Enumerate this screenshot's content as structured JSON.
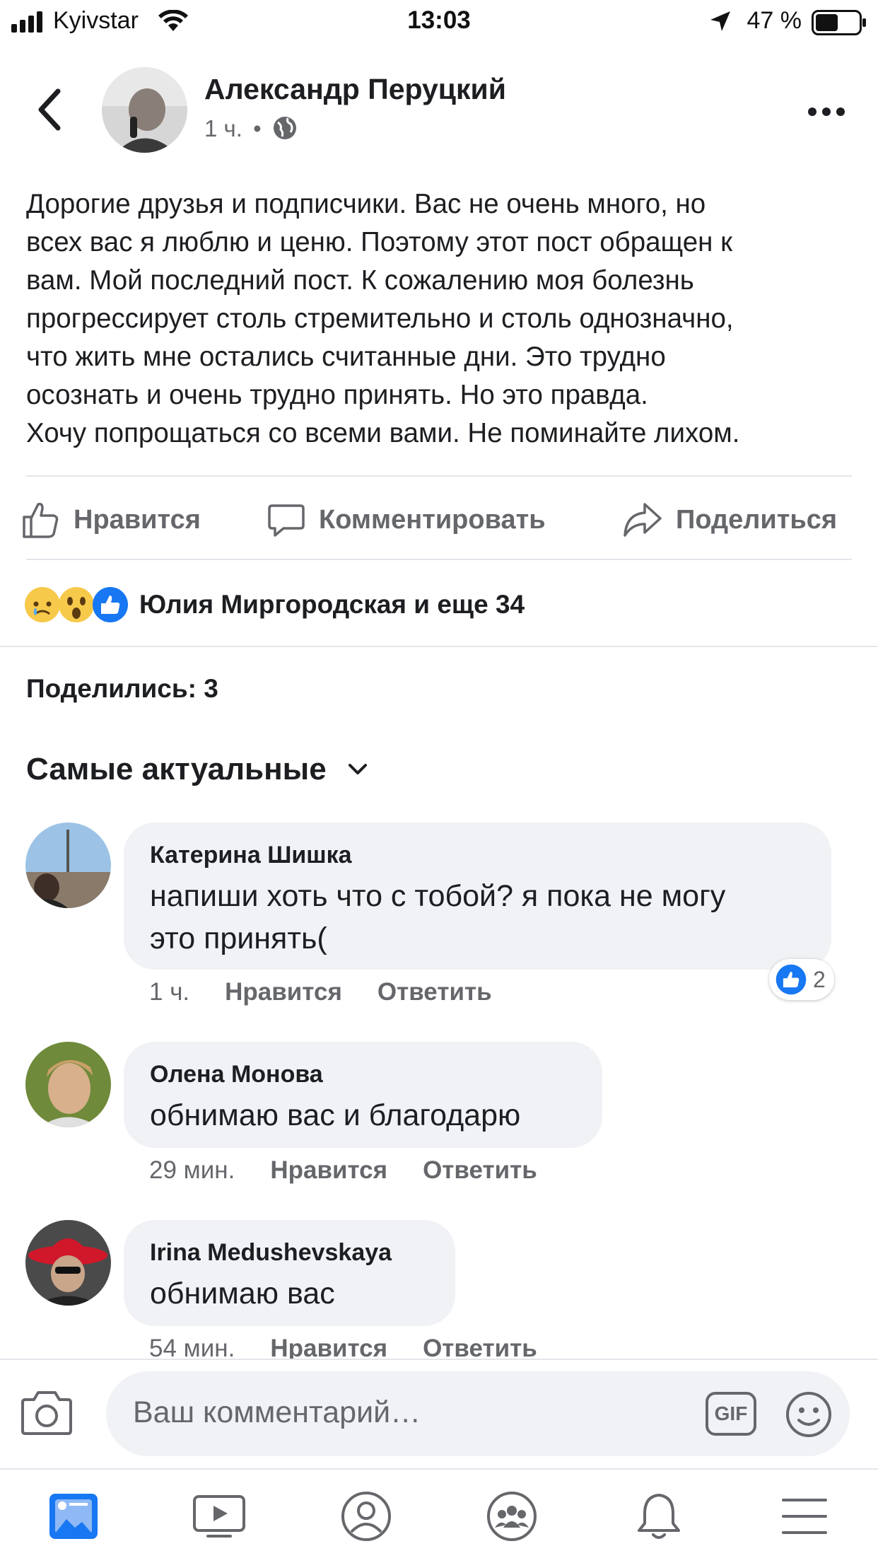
{
  "status_bar": {
    "carrier": "Kyivstar",
    "time": "13:03",
    "battery": "47 %"
  },
  "post": {
    "author": "Александр Перуцкий",
    "time": "1 ч.",
    "separator": "•",
    "text": "Дорогие друзья и подписчики. Вас не очень много, но\nвсех вас я люблю и ценю. Поэтому этот пост обращен к\nвам. Мой последний пост.  К сожалению моя болезнь\nпрогрессирует столь стремительно и столь однозначно,\nчто жить мне остались считанные дни. Это трудно\nосознать и очень трудно принять. Но это правда.\nХочу попрощаться со всеми вами. Не поминайте лихом."
  },
  "actions": {
    "like": "Нравится",
    "comment": "Комментировать",
    "share": "Поделиться"
  },
  "reactions": {
    "summary": "Юлия Миргородская и еще 34",
    "types": [
      "sad",
      "wow",
      "like"
    ]
  },
  "shares_text": "Поделились: 3",
  "sort_label": "Самые актуальные",
  "comments": [
    {
      "name": "Катерина Шишка",
      "text_line1": "напиши хоть что с тобой? я пока не могу",
      "text_line2": "это принять(",
      "time": "1 ч.",
      "like": "Нравится",
      "reply": "Ответить",
      "like_count": "2"
    },
    {
      "name": "Олена Монова",
      "text": "обнимаю вас и благодарю",
      "time": "29 мин.",
      "like": "Нравится",
      "reply": "Ответить"
    },
    {
      "name": "Irina Medushevskaya",
      "text": "обнимаю вас",
      "time": "54 мин.",
      "like": "Нравится",
      "reply": "Ответить"
    }
  ],
  "composer": {
    "placeholder": "Ваш комментарий…",
    "gif_label": "GIF"
  },
  "colors": {
    "fb_blue": "#1877f2",
    "text_primary": "#1c1e21",
    "text_secondary": "#65676b",
    "bubble_bg": "#f0f2f5"
  }
}
